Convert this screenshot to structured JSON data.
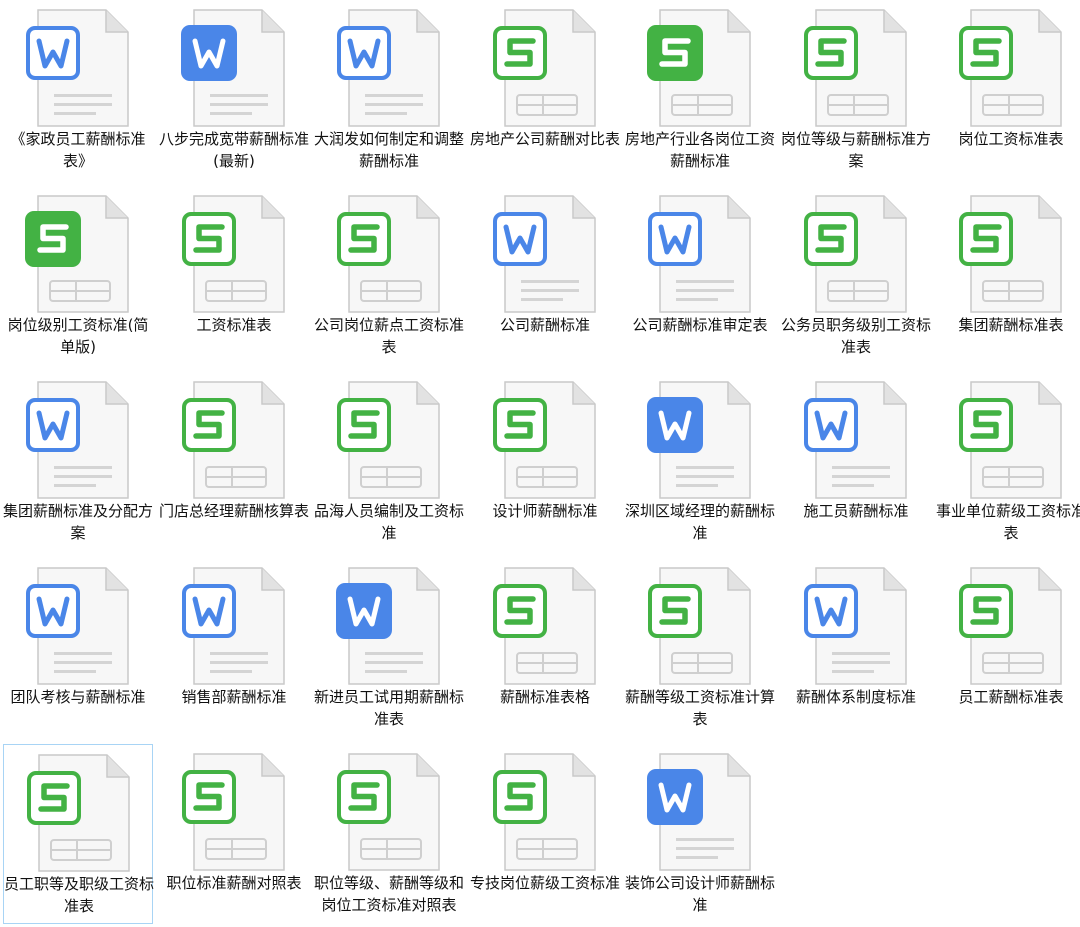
{
  "files": [
    {
      "name": "《家政员工薪酬标准表》",
      "type": "doc-outline"
    },
    {
      "name": "八步完成宽带薪酬标准(最新)",
      "type": "doc-solid"
    },
    {
      "name": "大润发如何制定和调整薪酬标准",
      "type": "doc-outline"
    },
    {
      "name": "房地产公司薪酬对比表",
      "type": "xls-outline"
    },
    {
      "name": "房地产行业各岗位工资薪酬标准",
      "type": "xls-solid"
    },
    {
      "name": "岗位等级与薪酬标准方案",
      "type": "xls-outline"
    },
    {
      "name": "岗位工资标准表",
      "type": "xls-outline"
    },
    {
      "name": "岗位级别工资标准(简单版)",
      "type": "xls-solid"
    },
    {
      "name": "工资标准表",
      "type": "xls-outline"
    },
    {
      "name": "公司岗位薪点工资标准表",
      "type": "xls-outline"
    },
    {
      "name": "公司薪酬标准",
      "type": "doc-outline"
    },
    {
      "name": "公司薪酬标准审定表",
      "type": "doc-outline"
    },
    {
      "name": "公务员职务级别工资标准表",
      "type": "xls-outline"
    },
    {
      "name": "集团薪酬标准表",
      "type": "xls-outline"
    },
    {
      "name": "集团薪酬标准及分配方案",
      "type": "doc-outline"
    },
    {
      "name": "门店总经理薪酬核算表",
      "type": "xls-outline"
    },
    {
      "name": "品海人员编制及工资标准",
      "type": "xls-outline"
    },
    {
      "name": "设计师薪酬标准",
      "type": "xls-outline"
    },
    {
      "name": "深圳区域经理的薪酬标准",
      "type": "doc-solid"
    },
    {
      "name": "施工员薪酬标准",
      "type": "doc-outline"
    },
    {
      "name": "事业单位薪级工资标准表",
      "type": "xls-outline"
    },
    {
      "name": "团队考核与薪酬标准",
      "type": "doc-outline"
    },
    {
      "name": "销售部薪酬标准",
      "type": "doc-outline"
    },
    {
      "name": "新进员工试用期薪酬标准表",
      "type": "doc-solid"
    },
    {
      "name": "薪酬标准表格",
      "type": "xls-outline"
    },
    {
      "name": "薪酬等级工资标准计算表",
      "type": "xls-outline"
    },
    {
      "name": "薪酬体系制度标准",
      "type": "doc-outline"
    },
    {
      "name": "员工薪酬标准表",
      "type": "xls-outline"
    },
    {
      "name": "员工职等及职级工资标准表",
      "type": "xls-outline",
      "selected": true
    },
    {
      "name": "职位标准薪酬对照表",
      "type": "xls-outline"
    },
    {
      "name": "职位等级、薪酬等级和岗位工资标准对照表",
      "type": "xls-outline"
    },
    {
      "name": "专技岗位薪级工资标准",
      "type": "xls-outline"
    },
    {
      "name": "装饰公司设计师薪酬标准",
      "type": "doc-solid"
    }
  ],
  "colors": {
    "doc": "#4a86e8",
    "xls": "#43b244",
    "page": "#f7f7f7",
    "page_border": "#c9c9c9",
    "fold": "#e2e2e2",
    "selection_border": "#a8d4f5"
  }
}
